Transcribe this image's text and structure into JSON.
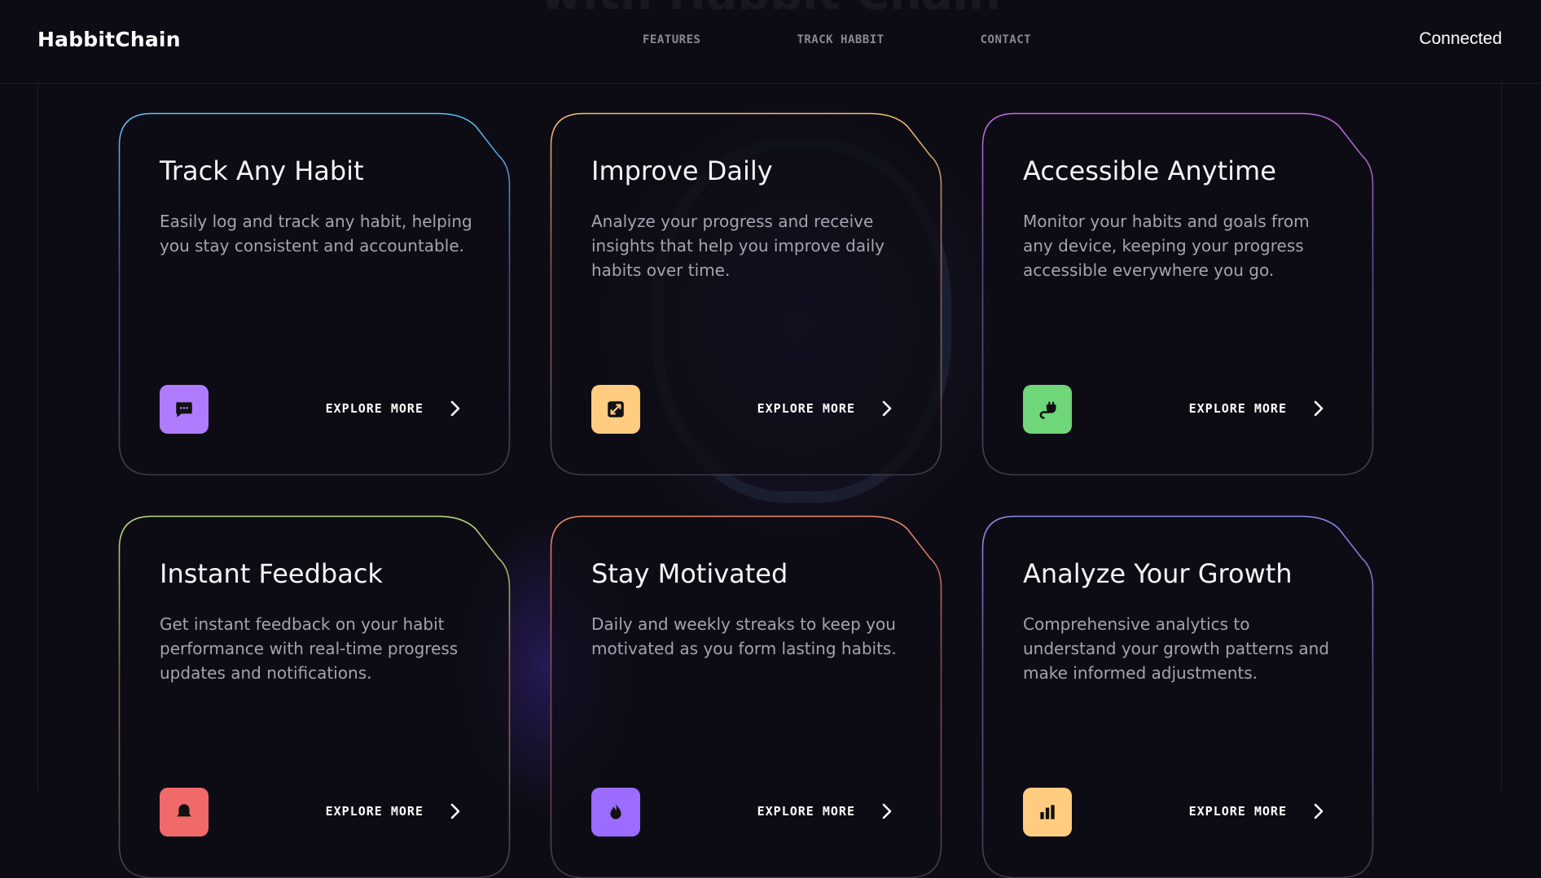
{
  "header": {
    "brand": "HabbitChain",
    "nav": [
      "FEATURES",
      "TRACK HABBIT",
      "CONTACT"
    ],
    "status": "Connected"
  },
  "background": {
    "ghost_heading": "with Habbit Chain"
  },
  "cards": [
    {
      "title": "Track Any Habit",
      "description": "Easily log and track any habit, helping you stay consistent and accountable.",
      "icon": "chat-bubble-icon",
      "icon_bg": "#b07cff",
      "accent_top": "#5fc3f0",
      "accent_bottom": "#6e7de8",
      "explore": "EXPLORE MORE"
    },
    {
      "title": "Improve Daily",
      "description": "Analyze your progress and receive insights that help you improve daily habits over time.",
      "icon": "expand-arrows-icon",
      "icon_bg": "#ffcc80",
      "accent_top": "#f2c26f",
      "accent_bottom": "#e0938a",
      "explore": "EXPLORE MORE"
    },
    {
      "title": "Accessible Anytime",
      "description": "Monitor your habits and goals from any device, keeping your progress accessible everywhere you go.",
      "icon": "plug-icon",
      "icon_bg": "#6fd67a",
      "accent_top": "#c16de0",
      "accent_bottom": "#9b7ae8",
      "explore": "EXPLORE MORE"
    },
    {
      "title": "Instant Feedback",
      "description": "Get instant feedback on your habit performance with real-time progress updates and notifications.",
      "icon": "bell-icon",
      "icon_bg": "#f06a6a",
      "accent_top": "#b9e07a",
      "accent_bottom": "#e0a06a",
      "explore": "EXPLORE MORE"
    },
    {
      "title": "Stay Motivated",
      "description": "Daily and weekly streaks to keep you motivated as you form lasting habits.",
      "icon": "flame-icon",
      "icon_bg": "#9b6cff",
      "accent_top": "#f08a6a",
      "accent_bottom": "#e26a7a",
      "explore": "EXPLORE MORE"
    },
    {
      "title": "Analyze Your Growth",
      "description": "Comprehensive analytics to understand your growth patterns and make informed adjustments.",
      "icon": "chart-icon",
      "icon_bg": "#ffcc80",
      "accent_top": "#8b8cf0",
      "accent_bottom": "#a77ae0",
      "explore": "EXPLORE MORE"
    }
  ]
}
